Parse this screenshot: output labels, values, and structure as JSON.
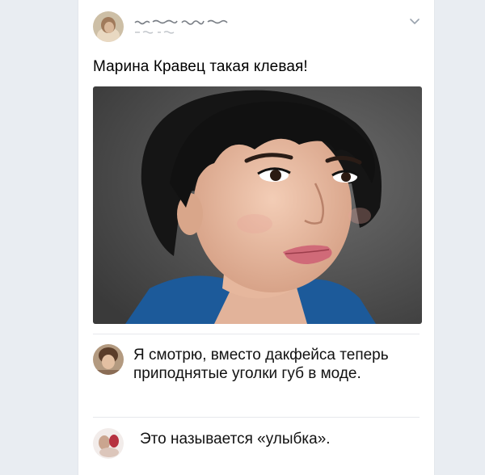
{
  "post": {
    "text": "Марина Кравец такая клевая!",
    "menu_icon": "chevron-down-icon"
  },
  "comments": [
    {
      "text": "Я смотрю, вместо дакфейса теперь приподнятые уголки губ в моде."
    },
    {
      "text": "Это называется «улыбка»."
    }
  ],
  "colors": {
    "page_background": "#e9edf2",
    "card_background": "#ffffff",
    "text": "#000000",
    "divider": "#e7e8ec"
  }
}
